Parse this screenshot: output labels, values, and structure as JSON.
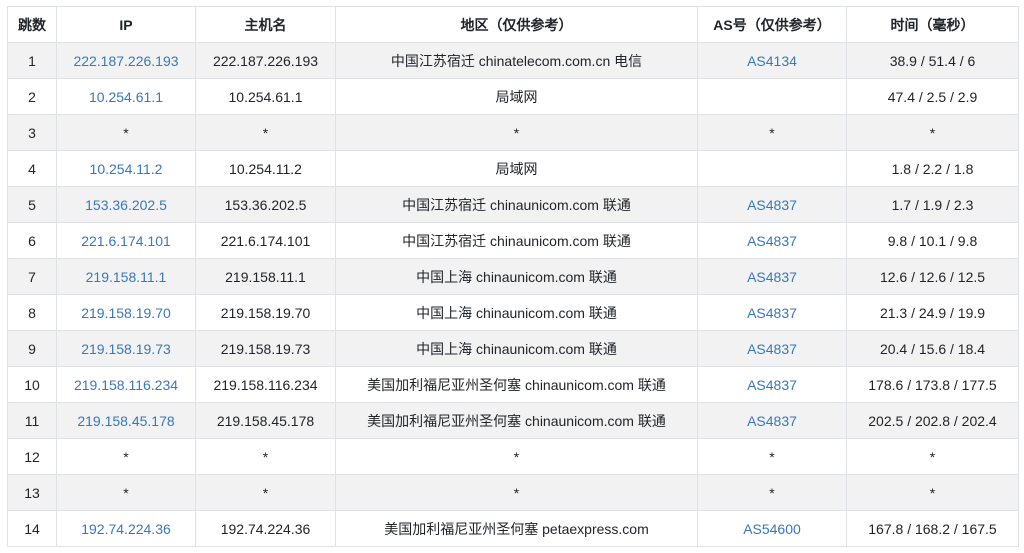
{
  "headers": [
    "跳数",
    "IP",
    "主机名",
    "地区（仅供参考）",
    "AS号（仅供参考）",
    "时间（毫秒）"
  ],
  "rows": [
    {
      "hop": "1",
      "ip": "222.187.226.193",
      "host": "222.187.226.193",
      "region": "中国江苏宿迁 chinatelecom.com.cn 电信",
      "as": "AS4134",
      "time": "38.9 / 51.4 / 6"
    },
    {
      "hop": "2",
      "ip": "10.254.61.1",
      "host": "10.254.61.1",
      "region": "局域网",
      "as": "",
      "time": "47.4 / 2.5 / 2.9"
    },
    {
      "hop": "3",
      "ip": "*",
      "host": "*",
      "region": "*",
      "as": "*",
      "time": "*"
    },
    {
      "hop": "4",
      "ip": "10.254.11.2",
      "host": "10.254.11.2",
      "region": "局域网",
      "as": "",
      "time": "1.8 / 2.2 / 1.8"
    },
    {
      "hop": "5",
      "ip": "153.36.202.5",
      "host": "153.36.202.5",
      "region": "中国江苏宿迁 chinaunicom.com 联通",
      "as": "AS4837",
      "time": "1.7 / 1.9 / 2.3"
    },
    {
      "hop": "6",
      "ip": "221.6.174.101",
      "host": "221.6.174.101",
      "region": "中国江苏宿迁 chinaunicom.com 联通",
      "as": "AS4837",
      "time": "9.8 / 10.1 / 9.8"
    },
    {
      "hop": "7",
      "ip": "219.158.11.1",
      "host": "219.158.11.1",
      "region": "中国上海 chinaunicom.com 联通",
      "as": "AS4837",
      "time": "12.6 / 12.6 / 12.5"
    },
    {
      "hop": "8",
      "ip": "219.158.19.70",
      "host": "219.158.19.70",
      "region": "中国上海 chinaunicom.com 联通",
      "as": "AS4837",
      "time": "21.3 / 24.9 / 19.9"
    },
    {
      "hop": "9",
      "ip": "219.158.19.73",
      "host": "219.158.19.73",
      "region": "中国上海 chinaunicom.com 联通",
      "as": "AS4837",
      "time": "20.4 / 15.6 / 18.4"
    },
    {
      "hop": "10",
      "ip": "219.158.116.234",
      "host": "219.158.116.234",
      "region": "美国加利福尼亚州圣何塞 chinaunicom.com 联通",
      "as": "AS4837",
      "time": "178.6 / 173.8 / 177.5"
    },
    {
      "hop": "11",
      "ip": "219.158.45.178",
      "host": "219.158.45.178",
      "region": "美国加利福尼亚州圣何塞 chinaunicom.com 联通",
      "as": "AS4837",
      "time": "202.5 / 202.8 / 202.4"
    },
    {
      "hop": "12",
      "ip": "*",
      "host": "*",
      "region": "*",
      "as": "*",
      "time": "*"
    },
    {
      "hop": "13",
      "ip": "*",
      "host": "*",
      "region": "*",
      "as": "*",
      "time": "*"
    },
    {
      "hop": "14",
      "ip": "192.74.224.36",
      "host": "192.74.224.36",
      "region": "美国加利福尼亚州圣何塞 petaexpress.com",
      "as": "AS54600",
      "time": "167.8 / 168.2 / 167.5"
    }
  ]
}
